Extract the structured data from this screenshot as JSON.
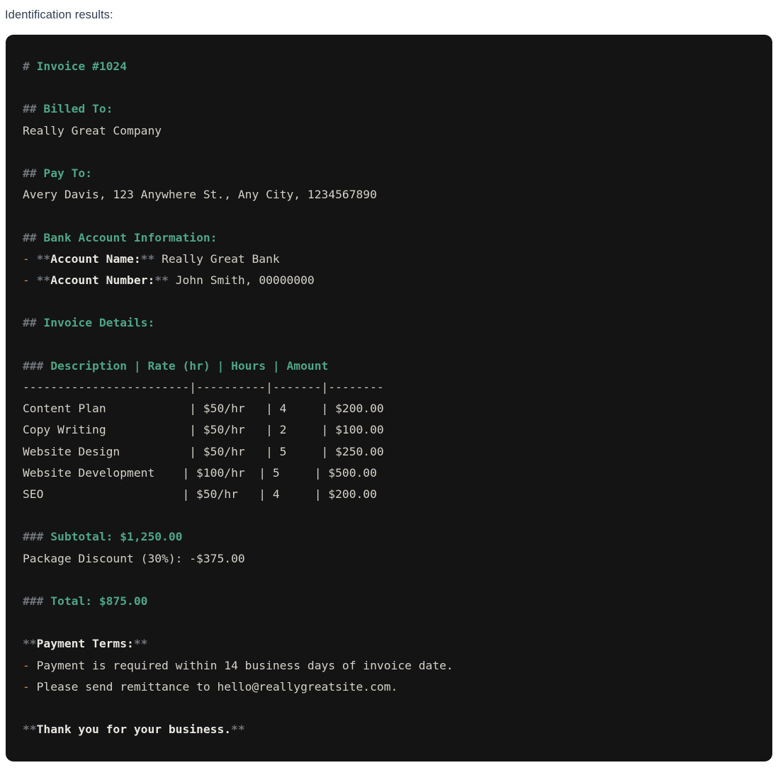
{
  "page": {
    "label": "Identification results:",
    "background": "#ffffff",
    "label_color": "#2f3d4f"
  },
  "code_block": {
    "background": "#141414",
    "border_radius_px": 11,
    "language": "markdown",
    "colors": {
      "marker": "#70757c",
      "heading": "#4fa586",
      "bold": "#e9e7e2",
      "bullet": "#cd8c5b",
      "text": "#d5d1c9",
      "rule": "#cbc7bf"
    }
  },
  "invoice": {
    "title_marker": "# ",
    "title": "Invoice #1024",
    "billed_to": {
      "heading_marker": "## ",
      "heading": "Billed To:",
      "value": "Really Great Company"
    },
    "pay_to": {
      "heading_marker": "## ",
      "heading": "Pay To:",
      "value": "Avery Davis, 123 Anywhere St., Any City, 1234567890"
    },
    "bank_account": {
      "heading_marker": "## ",
      "heading": "Bank Account Information:",
      "items": [
        {
          "bullet": "- ",
          "mark_open": "**",
          "label": "Account Name:",
          "mark_close": "** ",
          "value": "Really Great Bank"
        },
        {
          "bullet": "- ",
          "mark_open": "**",
          "label": "Account Number:",
          "mark_close": "** ",
          "value": "John Smith, 00000000"
        }
      ]
    },
    "details": {
      "heading_marker": "## ",
      "heading": "Invoice Details:",
      "table_header_marker": "### ",
      "table_header": "Description | Rate (hr) | Hours | Amount",
      "table_rule": "------------------------|----------|-------|--------",
      "rows": [
        "Content Plan            | $50/hr   | 4     | $200.00",
        "Copy Writing            | $50/hr   | 2     | $100.00",
        "Website Design          | $50/hr   | 5     | $250.00",
        "Website Development    | $100/hr  | 5     | $500.00",
        "SEO                    | $50/hr   | 4     | $200.00"
      ]
    },
    "subtotal": {
      "heading_marker": "### ",
      "heading": "Subtotal: $1,250.00",
      "discount_line": "Package Discount (30%): -$375.00"
    },
    "total": {
      "heading_marker": "### ",
      "heading": "Total: $875.00"
    },
    "payment_terms": {
      "mark_open": "**",
      "label": "Payment Terms:",
      "mark_close": "**",
      "items": [
        {
          "bullet": "- ",
          "text": "Payment is required within 14 business days of invoice date."
        },
        {
          "bullet": "- ",
          "text": "Please send remittance to hello@reallygreatsite.com."
        }
      ]
    },
    "closing": {
      "mark_open": "**",
      "text": "Thank you for your business.",
      "mark_close": "**"
    }
  }
}
